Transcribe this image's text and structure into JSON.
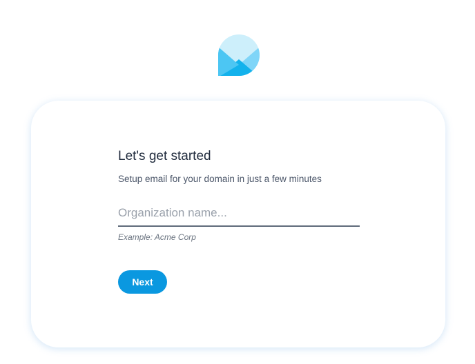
{
  "logo": {
    "icon": "envelope-chat-logo-icon",
    "colors": {
      "light": "#cdeffb",
      "mid": "#7fd5f8",
      "dark": "#13b2ec"
    }
  },
  "onboarding": {
    "title": "Let's get started",
    "subtitle": "Setup email for your domain in just a few minutes",
    "org_field": {
      "value": "",
      "placeholder": "Organization name..."
    },
    "hint": "Example: Acme Corp",
    "next_label": "Next"
  },
  "colors": {
    "accent": "#0a98e0",
    "card_shadow": "#78afe6"
  }
}
